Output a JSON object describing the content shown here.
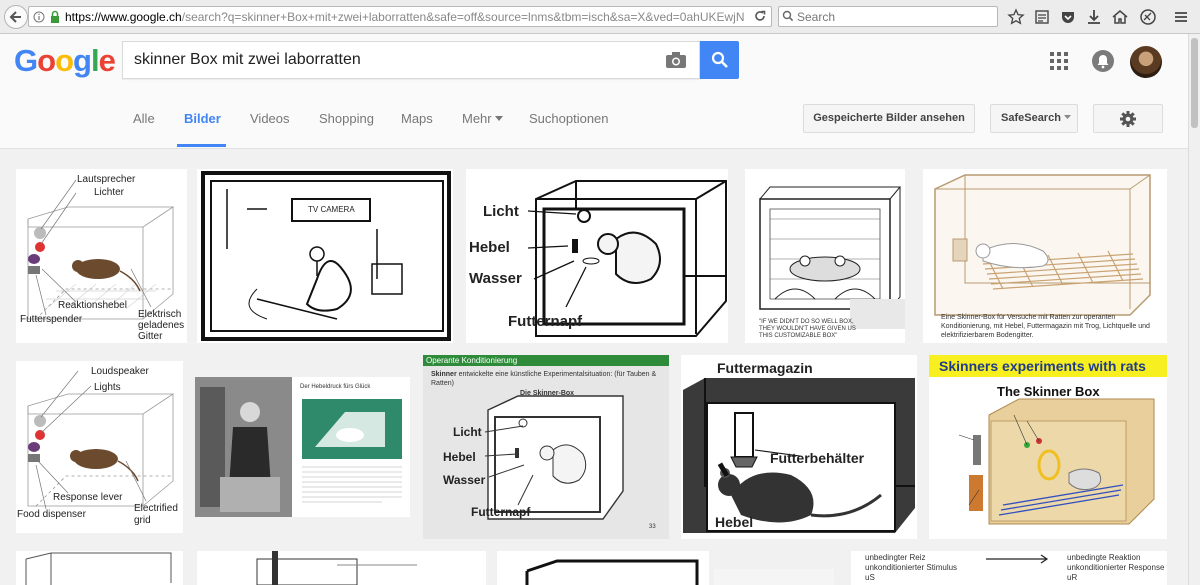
{
  "browser": {
    "url_host": "https://www.google.ch",
    "url_rest": "/search?q=skinner+Box+mit+zwei+laborratten&safe=off&source=lnms&tbm=isch&sa=X&ved=0ahUKEwjN6JeF",
    "search_placeholder": "Search"
  },
  "google": {
    "logo_letters": [
      "G",
      "o",
      "o",
      "g",
      "l",
      "e"
    ],
    "logo_colors": [
      "#4285f4",
      "#ea4335",
      "#fbbc05",
      "#4285f4",
      "#34a853",
      "#ea4335"
    ],
    "query": "skinner Box mit zwei laborratten",
    "accent": "#4285f4"
  },
  "nav": {
    "tabs": [
      "Alle",
      "Bilder",
      "Videos",
      "Shopping",
      "Maps",
      "Mehr",
      "Suchoptionen"
    ],
    "active": "Bilder",
    "saved_images": "Gespeicherte Bilder ansehen",
    "safesearch": "SafeSearch"
  },
  "results": {
    "r1": {
      "de_diagram": {
        "speaker": "Lautsprecher",
        "lights": "Lichter",
        "lever": "Reaktionshebel",
        "dispenser": "Futterspender",
        "grid": "Elektrisch geladenes Gitter"
      },
      "tv_camera": "TV CAMERA",
      "skinner_box_de": {
        "light": "Licht",
        "lever": "Hebel",
        "water": "Wasser",
        "food": "Futternapf"
      },
      "cartoon_caption": "\"IF WE DIDN'T DO SO WELL BOX, THEY WOULDN'T HAVE GIVEN US THIS CUSTOMIZABLE BOX\"",
      "grid_caption": "Eine Skinner-Box für Versuche mit Ratten zur operanten Konditionierung, mit Hebel, Futtermagazin mit Trog, Lichtquelle und elektrifizierbarem Bodengitter."
    },
    "r2": {
      "en_diagram": {
        "speaker": "Loudspeaker",
        "lights": "Lights",
        "lever": "Response lever",
        "dispenser": "Food dispenser",
        "grid": "Electrified grid"
      },
      "article_title": "Der Hebeldruck fürs Glück",
      "slide": {
        "header": "Operante Konditionierung",
        "text_bold": "Skinner",
        "text": "entwickelte eine künstliche Experimentalsituation: (für Tauben & Ratten)",
        "subtitle": "Die Skinner-Box",
        "light": "Licht",
        "lever": "Hebel",
        "water": "Wasser",
        "food": "Futternapf",
        "page": "33"
      },
      "magazin": {
        "title": "Futtermagazin",
        "container": "Futterbehälter",
        "lever": "Hebel"
      },
      "experiments": {
        "banner": "Skinners experiments with rats",
        "title": "The Skinner Box"
      }
    },
    "r3": {
      "reflex": {
        "l1": "unbedingter Reiz",
        "l2": "unkonditionierter Stimulus",
        "l3": "uS",
        "r1": "unbedingte Reaktion",
        "r2": "unkonditionierter Response",
        "r3": "uR"
      }
    }
  }
}
